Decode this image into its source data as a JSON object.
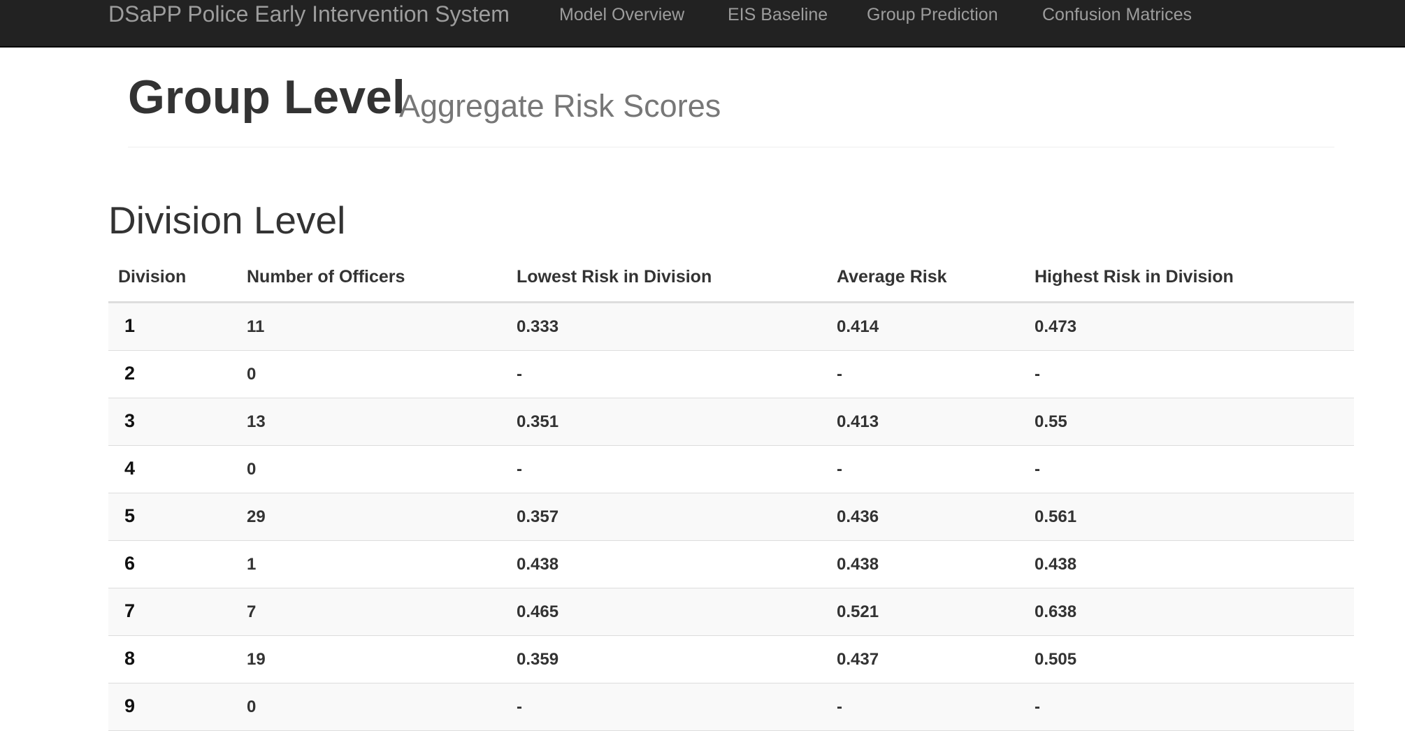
{
  "navbar": {
    "brand": "DSaPP Police Early Intervention System",
    "links": [
      {
        "label": "Model Overview"
      },
      {
        "label": "EIS Baseline"
      },
      {
        "label": "Group Prediction"
      },
      {
        "label": "Confusion Matrices"
      }
    ]
  },
  "header": {
    "title": "Group Level",
    "subtitle": "Aggregate Risk Scores"
  },
  "section": {
    "heading": "Division Level"
  },
  "table": {
    "columns": [
      "Division",
      "Number of Officers",
      "Lowest Risk in Division",
      "Average Risk",
      "Highest Risk in Division"
    ],
    "rows": [
      [
        "1",
        "11",
        "0.333",
        "0.414",
        "0.473"
      ],
      [
        "2",
        "0",
        "-",
        "-",
        "-"
      ],
      [
        "3",
        "13",
        "0.351",
        "0.413",
        "0.55"
      ],
      [
        "4",
        "0",
        "-",
        "-",
        "-"
      ],
      [
        "5",
        "29",
        "0.357",
        "0.436",
        "0.561"
      ],
      [
        "6",
        "1",
        "0.438",
        "0.438",
        "0.438"
      ],
      [
        "7",
        "7",
        "0.465",
        "0.521",
        "0.638"
      ],
      [
        "8",
        "19",
        "0.359",
        "0.437",
        "0.505"
      ],
      [
        "9",
        "0",
        "-",
        "-",
        "-"
      ]
    ]
  },
  "colors": {
    "navbar_bg": "#222222",
    "navbar_text": "#9d9d9d",
    "striped_row": "#f9f9f9",
    "border": "#dddddd"
  }
}
